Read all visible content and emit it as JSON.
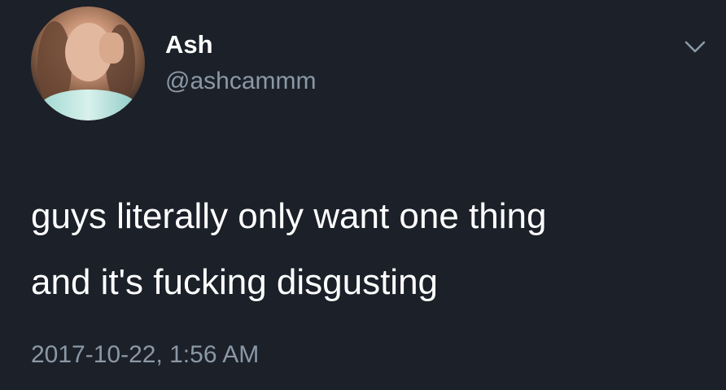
{
  "tweet": {
    "author": {
      "display_name": "Ash",
      "handle": "@ashcammm"
    },
    "text_lines": [
      "guys literally only want one thing",
      "and it's fucking disgusting"
    ],
    "timestamp": "2017-10-22, 1:56 AM"
  },
  "icons": {
    "avatar": "avatar",
    "menu": "chevron-down-icon"
  },
  "colors": {
    "background": "#1b2029",
    "primary_text": "#ffffff",
    "secondary_text": "#8b98a5"
  }
}
